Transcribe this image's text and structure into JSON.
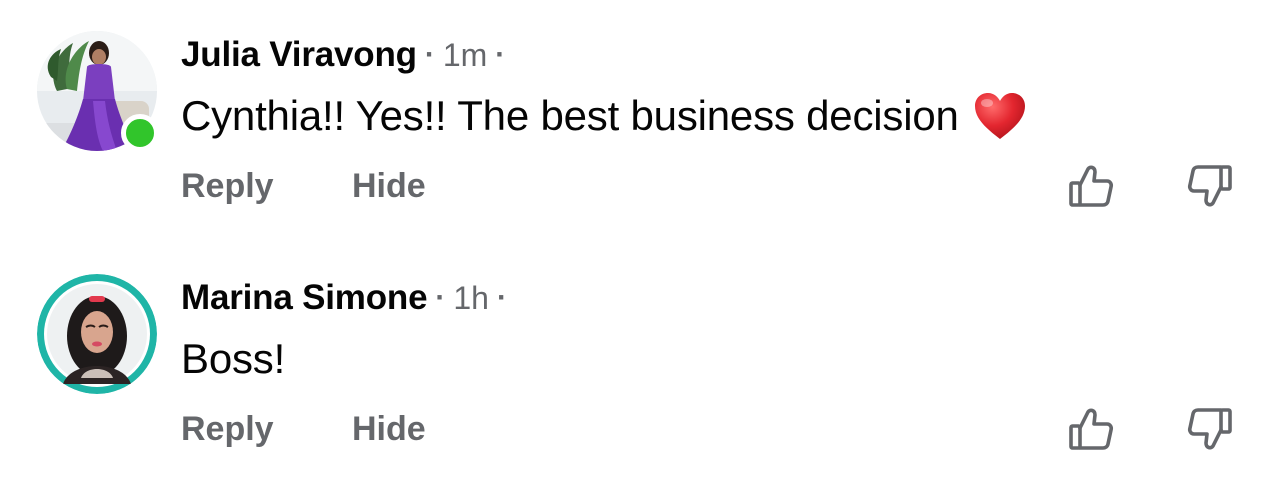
{
  "comments": [
    {
      "author": "Julia Viravong",
      "separator": "·",
      "time": "1m",
      "trailing_separator": "·",
      "text": "Cynthia!! Yes!! The best business decision",
      "emoji": "red-heart-emoji",
      "online": true,
      "actions": {
        "reply": "Reply",
        "hide": "Hide"
      },
      "icons": {
        "upvote": "thumbs-up-outline-icon",
        "downvote": "thumbs-down-outline-icon"
      }
    },
    {
      "author": "Marina Simone",
      "separator": "·",
      "time": "1h",
      "trailing_separator": "·",
      "text": "Boss!",
      "online": false,
      "actions": {
        "reply": "Reply",
        "hide": "Hide"
      },
      "icons": {
        "upvote": "thumbs-up-outline-icon",
        "downvote": "thumbs-down-outline-icon"
      }
    }
  ],
  "colors": {
    "text_primary": "#050505",
    "text_secondary": "#65676b",
    "online_indicator": "#31c52b",
    "avatar_ring": "#1fb5a7",
    "heart": "#e3262f"
  }
}
